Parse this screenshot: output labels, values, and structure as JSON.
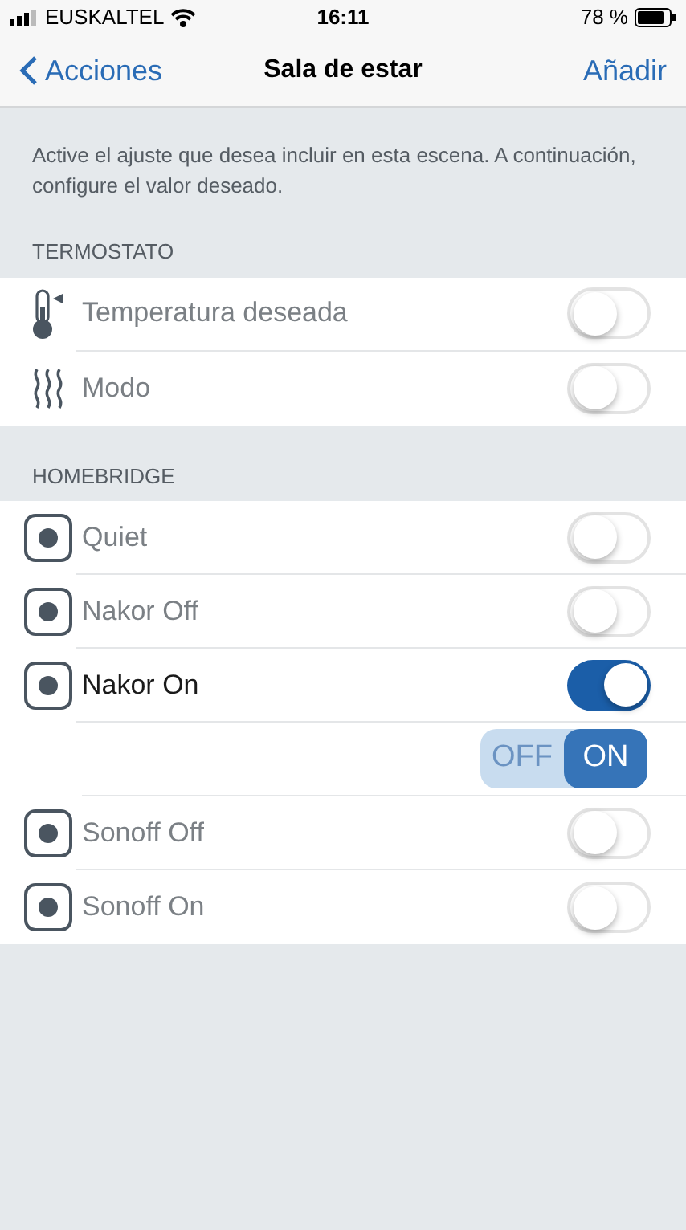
{
  "status_bar": {
    "carrier": "EUSKALTEL",
    "time": "16:11",
    "battery": "78 %"
  },
  "nav": {
    "back": "Acciones",
    "title": "Sala de estar",
    "action": "Añadir"
  },
  "description": "Active el ajuste que desea incluir en esta escena. A continuación, configure el valor deseado.",
  "sections": [
    {
      "header": "TERMOSTATO",
      "items": [
        {
          "kind": "thermometer",
          "label": "Temperatura deseada",
          "on": false
        },
        {
          "kind": "heat",
          "label": "Modo",
          "on": false
        }
      ]
    },
    {
      "header": "HOMEBRIDGE",
      "items": [
        {
          "kind": "scene",
          "label": "Quiet",
          "on": false
        },
        {
          "kind": "scene",
          "label": "Nakor Off",
          "on": false
        },
        {
          "kind": "scene",
          "label": "Nakor On",
          "on": true,
          "options": [
            {
              "label": "OFF",
              "selected": false
            },
            {
              "label": "ON",
              "selected": true
            }
          ]
        },
        {
          "kind": "scene",
          "label": "Sonoff Off",
          "on": false
        },
        {
          "kind": "scene",
          "label": "Sonoff On",
          "on": false
        }
      ]
    }
  ]
}
